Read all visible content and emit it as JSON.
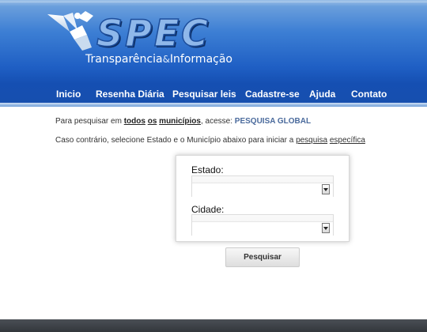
{
  "header": {
    "logo_text": "SPEC",
    "tagline_part1": "Transparência",
    "tagline_amp": "&",
    "tagline_part2": "Informação"
  },
  "nav": {
    "items": [
      {
        "label": "Inicio"
      },
      {
        "label": "Resenha Diária"
      },
      {
        "label": "Pesquisar leis"
      },
      {
        "label": "Cadastre-se"
      },
      {
        "label": "Ajuda"
      },
      {
        "label": "Contato"
      }
    ]
  },
  "intro": {
    "line1_prefix": "Para pesquisar em",
    "line1_todos": "todos",
    "line1_os": "os",
    "line1_municipios": "municípios",
    "line1_suffix": ", acesse:",
    "line1_link": "PESQUISA GLOBAL",
    "line2_prefix": "Caso contrário, selecione Estado e o Município abaixo para iniciar a",
    "line2_pesquisa": "pesquisa",
    "line2_especifica": "específica"
  },
  "form": {
    "estado_label": "Estado:",
    "estado_value": "",
    "cidade_label": "Cidade:",
    "cidade_value": "",
    "submit_label": "Pesquisar"
  },
  "colors": {
    "header_blue": "#1f5fc4",
    "link_blue": "#4a6a9c",
    "footer": "#3a3e43"
  }
}
